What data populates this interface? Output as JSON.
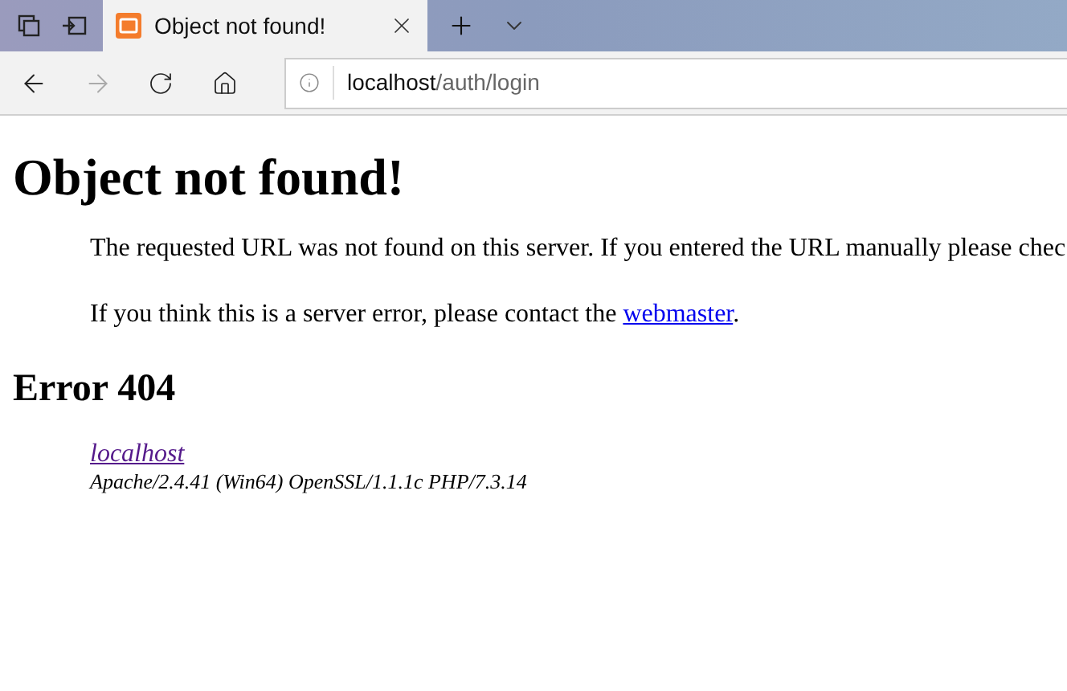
{
  "tabs": [
    {
      "title": "Object not found!",
      "selected": true
    }
  ],
  "toolbar": {
    "back": {
      "disabled": false
    },
    "forward": {
      "disabled": true
    },
    "address": {
      "host": "localhost",
      "path": "/auth/login"
    }
  },
  "page": {
    "heading": "Object not found!",
    "paragraphs": [
      "The requested URL was not found on this server. If you entered the URL manually please chec"
    ],
    "contact": {
      "before": "If you think this is a server error, please contact the ",
      "link": "webmaster",
      "after": "."
    },
    "error_heading": "Error 404",
    "address_link": "localhost",
    "server": "Apache/2.4.41 (Win64) OpenSSL/1.1.1c PHP/7.3.14"
  }
}
